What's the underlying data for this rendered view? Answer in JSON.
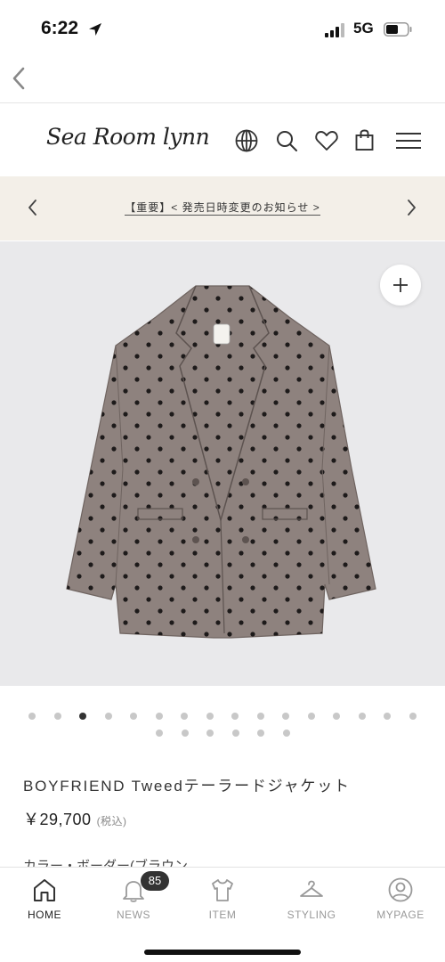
{
  "status_bar": {
    "time": "6:22",
    "network": "5G"
  },
  "header": {
    "logo": "Sea Room lynn"
  },
  "notice": {
    "text": "【重要】< 発売日時変更のお知らせ >"
  },
  "gallery": {
    "dot_count": 22,
    "active_index": 2
  },
  "product": {
    "name": "BOYFRIEND Tweedテーラードジャケット",
    "price": "￥29,700",
    "tax_note": "(税込)",
    "next_label": "カラー・ボーダー(ブラウン"
  },
  "tabbar": {
    "tabs": [
      {
        "label": "HOME"
      },
      {
        "label": "NEWS",
        "badge": "85"
      },
      {
        "label": "ITEM"
      },
      {
        "label": "STYLING"
      },
      {
        "label": "MYPAGE"
      }
    ]
  }
}
